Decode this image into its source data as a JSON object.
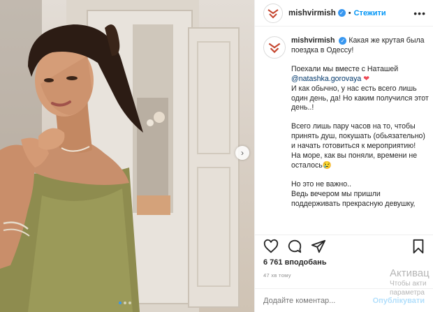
{
  "post": {
    "username": "mishvirmish",
    "separator": "•",
    "follow_label": "Стежити",
    "more_label": "•••",
    "next_arrow": "›",
    "caption_paragraphs": [
      "Какая же крутая была поездка в Одессу!",
      "",
      "Поехали мы вместе с Наташей",
      "@natashka.gorovaya",
      "И как обычно, у нас есть всего лишь один день, да! Но каким получился этот день..!",
      "Всего лишь пару часов на то, чтобы принять душ, покушать (обьязательно) и начать готовиться к мероприятию!",
      "На море, как вы поняли, времени не осталось😢",
      "Но это не важно..",
      "Ведь вечером мы пришли поддерживать прекрасную девушку,"
    ],
    "heart": "❤",
    "likes": "6 761 вподобань",
    "time": "47 хв тому",
    "comment_placeholder": "Додайте коментар...",
    "publish_label": "Опублікувати",
    "carousel_dots": 3
  },
  "icons": {
    "verified": "verified-badge-icon",
    "like": "heart-icon",
    "comment": "comment-icon",
    "share": "share-icon",
    "save": "bookmark-icon"
  },
  "overlay": {
    "line1": "Активац",
    "line2": "Чтобы акти",
    "line3": "параметра"
  },
  "colors": {
    "link_blue": "#0095f6",
    "mention": "#00376b",
    "heart": "#ed4956",
    "muted": "#8e8e8e"
  }
}
